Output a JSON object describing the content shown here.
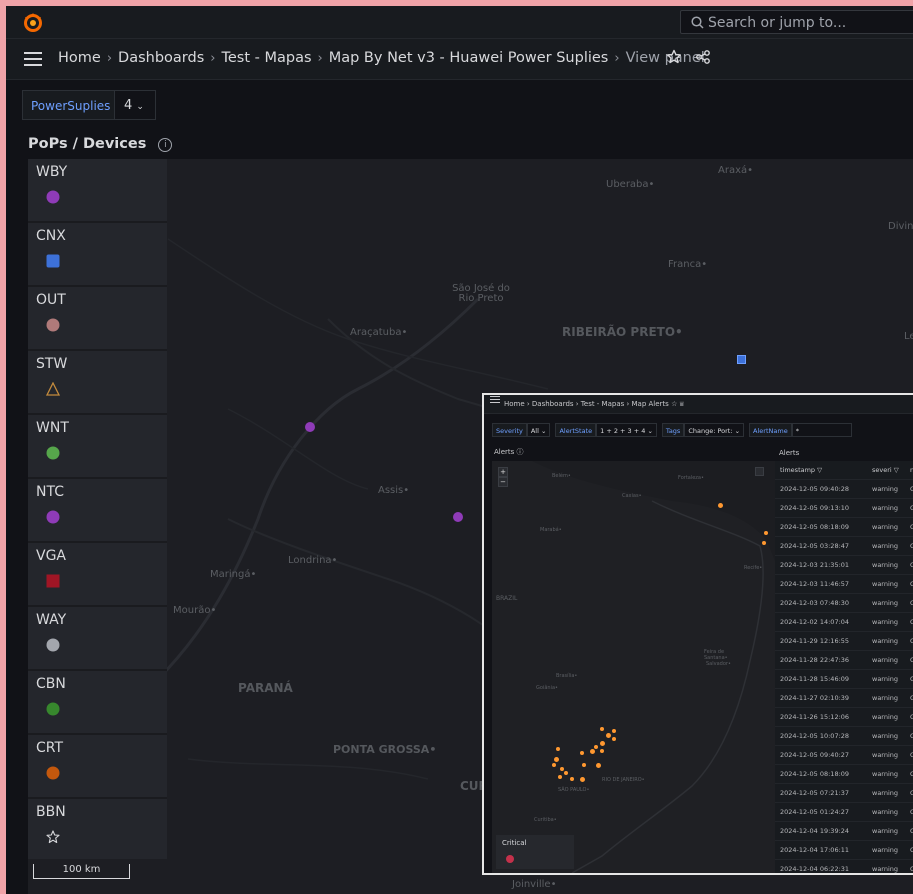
{
  "search": {
    "placeholder": "Search or jump to..."
  },
  "breadcrumb": [
    {
      "label": "Home"
    },
    {
      "label": "Dashboards"
    },
    {
      "label": "Test - Mapas"
    },
    {
      "label": "Map By Net v3 - Huawei Power Suplies"
    },
    {
      "label": "View panel"
    }
  ],
  "variables": {
    "label": "PowerSuplies",
    "value": "4"
  },
  "panel": {
    "title": "PoPs / Devices"
  },
  "legend": [
    {
      "label": "WBY",
      "shape": "circle",
      "color": "#8f3bb8"
    },
    {
      "label": "CNX",
      "shape": "square",
      "color": "#3d71d9"
    },
    {
      "label": "OUT",
      "shape": "circle",
      "color": "#b07a7a"
    },
    {
      "label": "STW",
      "shape": "triangle",
      "color": "#c28a3d"
    },
    {
      "label": "WNT",
      "shape": "circle",
      "color": "#56a64b"
    },
    {
      "label": "NTC",
      "shape": "circle",
      "color": "#8f3bb8"
    },
    {
      "label": "VGA",
      "shape": "square",
      "color": "#c4162a"
    },
    {
      "label": "WAY",
      "shape": "circle",
      "color": "#a3a6ad"
    },
    {
      "label": "CBN",
      "shape": "circle",
      "color": "#37872d"
    },
    {
      "label": "CRT",
      "shape": "circle",
      "color": "#fa6400"
    },
    {
      "label": "BBN",
      "shape": "star",
      "color": "#d8d9dc"
    }
  ],
  "scale_label": "100 km",
  "map_labels": [
    {
      "text": "Araxá•"
    },
    {
      "text": "Uberaba•"
    },
    {
      "text": "Divin"
    },
    {
      "text": "Franca•"
    },
    {
      "text": "São José do Rio Preto"
    },
    {
      "text": "Araçatuba•"
    },
    {
      "text": "RIBEIRÃO PRETO•"
    },
    {
      "text": "Le"
    },
    {
      "text": "Assis•"
    },
    {
      "text": "Londrina•"
    },
    {
      "text": "Maringá•"
    },
    {
      "text": "Mourão•"
    },
    {
      "text": "PARANÁ"
    },
    {
      "text": "PONTA GROSSA•"
    },
    {
      "text": "CUR"
    },
    {
      "text": "Joinville•"
    }
  ],
  "overlay": {
    "breadcrumb": "Home › Dashboards › Test - Mapas › Map Alerts",
    "variables": [
      {
        "label": "Severity",
        "value": "All ⌄"
      },
      {
        "label": "AlertState",
        "value": "1 + 2 + 3 + 4 ⌄"
      },
      {
        "label": "Tags",
        "value": "Change: Port: ⌄"
      },
      {
        "label": "AlertName",
        "value": "*"
      }
    ],
    "left_panel_title": "Alerts",
    "right_panel_title": "Alerts",
    "columns": [
      "timestamp",
      "severi",
      "n"
    ],
    "map_labels": [
      "Belém•",
      "Fortaleza•",
      "Caxias•",
      "Marabá•",
      "Recife•",
      "BRAZIL",
      "Feira de Santana•",
      "Salvador•",
      "Brasília•",
      "Goiânia•",
      "RIO DE JANEIRO•",
      "SÃO PAULO•",
      "Curitiba•"
    ],
    "critical_label": "Critical",
    "rows": [
      {
        "timestamp": "2024-12-05 09:40:28",
        "severity": "warning",
        "rest": "C"
      },
      {
        "timestamp": "2024-12-05 09:13:10",
        "severity": "warning",
        "rest": "C"
      },
      {
        "timestamp": "2024-12-05 08:18:09",
        "severity": "warning",
        "rest": "C"
      },
      {
        "timestamp": "2024-12-05 03:28:47",
        "severity": "warning",
        "rest": "C"
      },
      {
        "timestamp": "2024-12-03 21:35:01",
        "severity": "warning",
        "rest": "C"
      },
      {
        "timestamp": "2024-12-03 11:46:57",
        "severity": "warning",
        "rest": "C"
      },
      {
        "timestamp": "2024-12-03 07:48:30",
        "severity": "warning",
        "rest": "C"
      },
      {
        "timestamp": "2024-12-02 14:07:04",
        "severity": "warning",
        "rest": "C"
      },
      {
        "timestamp": "2024-11-29 12:16:55",
        "severity": "warning",
        "rest": "C"
      },
      {
        "timestamp": "2024-11-28 22:47:36",
        "severity": "warning",
        "rest": "C"
      },
      {
        "timestamp": "2024-11-28 15:46:09",
        "severity": "warning",
        "rest": "C"
      },
      {
        "timestamp": "2024-11-27 02:10:39",
        "severity": "warning",
        "rest": "C"
      },
      {
        "timestamp": "2024-11-26 15:12:06",
        "severity": "warning",
        "rest": "C"
      },
      {
        "timestamp": "2024-12-05 10:07:28",
        "severity": "warning",
        "rest": "C"
      },
      {
        "timestamp": "2024-12-05 09:40:27",
        "severity": "warning",
        "rest": "C"
      },
      {
        "timestamp": "2024-12-05 08:18:09",
        "severity": "warning",
        "rest": "C"
      },
      {
        "timestamp": "2024-12-05 07:21:37",
        "severity": "warning",
        "rest": "C"
      },
      {
        "timestamp": "2024-12-05 01:24:27",
        "severity": "warning",
        "rest": "C"
      },
      {
        "timestamp": "2024-12-04 19:39:24",
        "severity": "warning",
        "rest": "C"
      },
      {
        "timestamp": "2024-12-04 17:06:11",
        "severity": "warning",
        "rest": "C"
      },
      {
        "timestamp": "2024-12-04 06:22:31",
        "severity": "warning",
        "rest": "C"
      }
    ]
  }
}
